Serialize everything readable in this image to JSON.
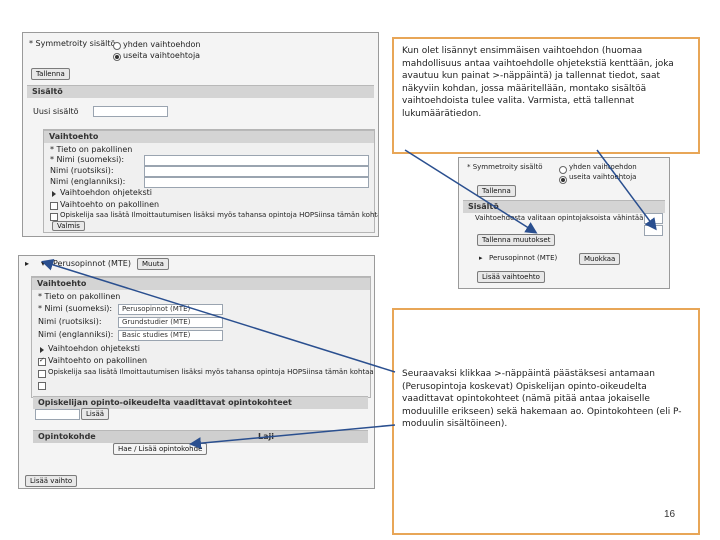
{
  "screenshot1": {
    "symmetric_label": "* Symmetroity sisältö",
    "radio_single": "yhden vaihtoehdon",
    "radio_multi": "useita vaihtoehtoja",
    "save_button": "Tallenna",
    "section_title": "Sisältö",
    "new_content": "Uusi sisältö",
    "fieldset_title": "Vaihtoehto",
    "field_required_note": "* Tieto on pakollinen",
    "field_name_fi": "* Nimi (suomeksi):",
    "field_name_sv": "Nimi (ruotsiksi):",
    "field_name_en": "Nimi (englanniksi):",
    "help_text_toggle": "Vaihtoehdon ohjeteksti",
    "required_checkbox": "Vaihtoehto on pakollinen",
    "course_checkbox": "Opiskelija saa lisätä Ilmoittautumisen lisäksi myös tahansa opintoja HOPSiinsa tämän kohtaan",
    "ready_button": "Valmis"
  },
  "screenshot2": {
    "symmetric_label": "* Symmetroity sisältö",
    "radio_single": "yhden vaihtoehdon",
    "radio_multi": "useita vaihtoehtoja",
    "save_button": "Tallenna",
    "section_title": "Sisältö",
    "row_text": "Vaihtoehdosta valitaan opintojaksoista vähintään",
    "save_changes_button": "Tallenna muutokset",
    "item_label": "Perusopinnot (MTE)",
    "edit_button": "Muokkaa",
    "new_option_button": "Lisää vaihtoehto"
  },
  "screenshot3": {
    "header_item": "Perusopinnot (MTE)",
    "header_button": "Muuta",
    "fieldset_title": "Vaihtoehto",
    "field_required_note": "* Tieto on pakollinen",
    "field_name_fi": "* Nimi (suomeksi):",
    "field_name_sv": "Nimi (ruotsiksi):",
    "field_name_en": "Nimi (englanniksi):",
    "value_fi": "Perusopinnot (MTE)",
    "value_sv": "Grundstudier (MTE)",
    "value_en": "Basic studies (MTE)",
    "help_text_toggle": "Vaihtoehdon ohjeteksti",
    "required_checkbox": "Vaihtoehto on pakollinen",
    "course_checkbox": "Opiskelija saa lisätä Ilmoittautumisen lisäksi myös tahansa opintoja HOPSiinsa tämän kohtaan",
    "credits_title": "Opiskelijan opinto-oikeudelta vaadittavat opintokohteet",
    "add_button": "Lisää",
    "table_col_course": "Opintokohde",
    "table_col_type": "Laji",
    "search_link": "Hae / Lisää opintokohde",
    "bottom_button": "Lisää vaihto"
  },
  "note1": "Kun olet lisännyt ensimmäisen vaihtoehdon (huomaa mahdollisuus antaa vaihtoehdolle ohjetekstiä kenttään, joka avautuu kun painat >-näppäintä) ja tallennat tiedot, saat näkyviin kohdan, jossa määritellään, montako sisältöä vaihtoehdoista tulee valita. Varmista, että tallennat lukumäärätiedon.",
  "note2": "Seuraavaksi klikkaa >-näppäintä päästäksesi antamaan (Perusopintoja koskevat) Opiskelijan opinto-oikeudelta vaadittavat opintokohteet (nämä pitää antaa jokaiselle moduulille erikseen) sekä hakemaan ao. Opintokohteen (eli P-moduulin sisältöineen).",
  "page_number": "16",
  "colors": {
    "note_border": "#e8a657",
    "arrow": "#2a4f8f"
  }
}
